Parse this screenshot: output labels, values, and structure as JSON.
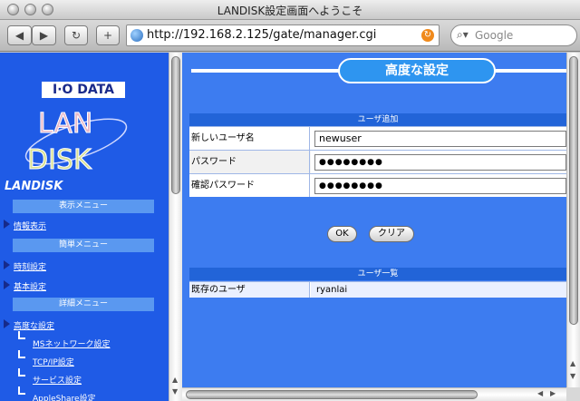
{
  "window": {
    "title": "LANDISK設定画面へようこそ"
  },
  "toolbar": {
    "back_glyph": "◀",
    "forward_glyph": "▶",
    "reload_glyph": "↻",
    "add_glyph": "+",
    "url": "http://192.168.2.125/gate/manager.cgi",
    "search_placeholder": "Google"
  },
  "sidebar": {
    "logo_text": "I·O DATA",
    "logo_lan": "LAN",
    "logo_disk": "DISK",
    "brand": "LANDISK",
    "sections": [
      {
        "title": "表示メニュー",
        "items": [
          "情報表示"
        ]
      },
      {
        "title": "簡単メニュー",
        "items": [
          "時刻設定",
          "基本設定"
        ]
      },
      {
        "title": "詳細メニュー",
        "items": [
          "高度な設定"
        ]
      }
    ],
    "sub_items": [
      "MSネットワーク設定",
      "TCP/IP設定",
      "サービス設定",
      "AppleShare設定"
    ]
  },
  "main": {
    "heading": "高度な設定",
    "add_user": {
      "header": "ユーザ追加",
      "fields": [
        {
          "label": "新しいユーザ名",
          "value": "newuser"
        },
        {
          "label": "パスワード",
          "value": "●●●●●●●●"
        },
        {
          "label": "確認パスワード",
          "value": "●●●●●●●●"
        }
      ]
    },
    "buttons": {
      "ok": "OK",
      "clear": "クリア"
    },
    "user_list": {
      "header": "ユーザ一覧",
      "label": "既存のユーザ",
      "value": "ryanlai"
    }
  },
  "colors": {
    "accent": "#1f5be6",
    "panel": "#3d7cf0",
    "header": "#2264d8"
  },
  "icons": [
    "globe-icon",
    "reload-icon",
    "search-icon",
    "triangle-icon"
  ]
}
